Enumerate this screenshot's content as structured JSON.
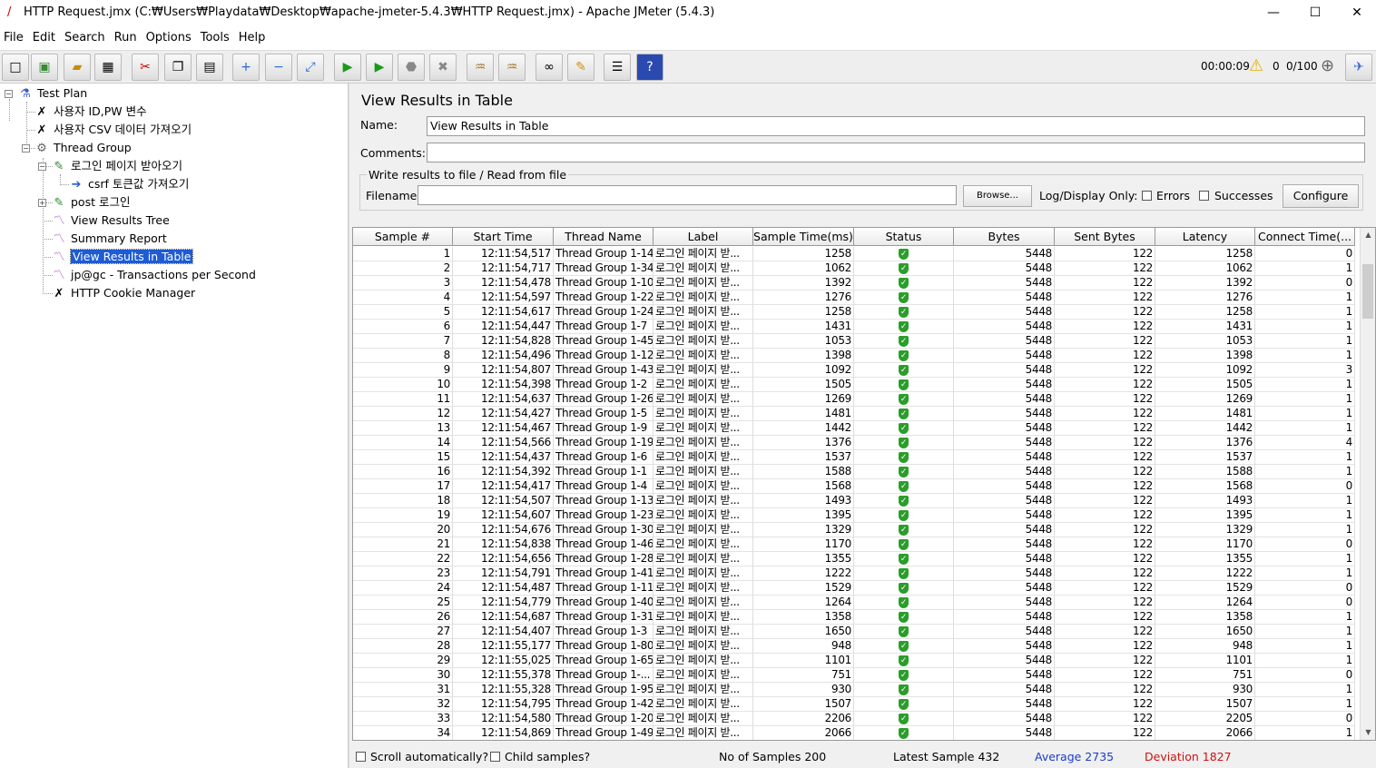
{
  "window": {
    "title": "HTTP Request.jmx (C:₩Users₩Playdata₩Desktop₩apache-jmeter-5.4.3₩HTTP Request.jmx) - Apache JMeter (5.4.3)",
    "minimize": "—",
    "maximize": "☐",
    "close": "✕"
  },
  "menu": [
    "File",
    "Edit",
    "Search",
    "Run",
    "Options",
    "Tools",
    "Help"
  ],
  "toolbar": {
    "elapsed": "00:00:09",
    "warnings": "0",
    "threads": "0/100"
  },
  "tree": [
    {
      "label": "Test Plan",
      "icon": "test-plan-icon"
    },
    {
      "label": "사용자 ID,PW 변수",
      "icon": "wrench-icon"
    },
    {
      "label": "사용자 CSV 데이터 가져오기",
      "icon": "wrench-icon"
    },
    {
      "label": "Thread Group",
      "icon": "gear-icon"
    },
    {
      "label": "로그인 페이지 받아오기",
      "icon": "pipette-icon"
    },
    {
      "label": "csrf 토큰값 가져오기",
      "icon": "extractor-icon"
    },
    {
      "label": "post 로그인",
      "icon": "pipette-icon"
    },
    {
      "label": "View Results Tree",
      "icon": "chart-icon"
    },
    {
      "label": "Summary Report",
      "icon": "chart-icon"
    },
    {
      "label": "View Results in Table",
      "icon": "chart-icon"
    },
    {
      "label": "jp@gc - Transactions per Second",
      "icon": "chart-icon"
    },
    {
      "label": "HTTP Cookie Manager",
      "icon": "wrench-icon"
    }
  ],
  "panel": {
    "title": "View Results in Table",
    "name_label": "Name:",
    "name_value": "View Results in Table",
    "comments_label": "Comments:",
    "comments_value": "",
    "file_section": "Write results to file / Read from file",
    "filename_label": "Filename",
    "filename_value": "",
    "browse": "Browse...",
    "log_display": "Log/Display Only:",
    "errors": "Errors",
    "successes": "Successes",
    "configure": "Configure"
  },
  "table": {
    "columns": [
      "Sample #",
      "Start Time",
      "Thread Name",
      "Label",
      "Sample Time(ms)",
      "Status",
      "Bytes",
      "Sent Bytes",
      "Latency",
      "Connect Time(..."
    ],
    "rows": [
      [
        "1",
        "12:11:54,517",
        "Thread Group 1-14",
        "로그인 페이지 받...",
        "1258",
        "5448",
        "122",
        "1258",
        "0"
      ],
      [
        "2",
        "12:11:54,717",
        "Thread Group 1-34",
        "로그인 페이지 받...",
        "1062",
        "5448",
        "122",
        "1062",
        "1"
      ],
      [
        "3",
        "12:11:54,478",
        "Thread Group 1-10",
        "로그인 페이지 받...",
        "1392",
        "5448",
        "122",
        "1392",
        "0"
      ],
      [
        "4",
        "12:11:54,597",
        "Thread Group 1-22",
        "로그인 페이지 받...",
        "1276",
        "5448",
        "122",
        "1276",
        "1"
      ],
      [
        "5",
        "12:11:54,617",
        "Thread Group 1-24",
        "로그인 페이지 받...",
        "1258",
        "5448",
        "122",
        "1258",
        "1"
      ],
      [
        "6",
        "12:11:54,447",
        "Thread Group 1-7",
        "로그인 페이지 받...",
        "1431",
        "5448",
        "122",
        "1431",
        "1"
      ],
      [
        "7",
        "12:11:54,828",
        "Thread Group 1-45",
        "로그인 페이지 받...",
        "1053",
        "5448",
        "122",
        "1053",
        "1"
      ],
      [
        "8",
        "12:11:54,496",
        "Thread Group 1-12",
        "로그인 페이지 받...",
        "1398",
        "5448",
        "122",
        "1398",
        "1"
      ],
      [
        "9",
        "12:11:54,807",
        "Thread Group 1-43",
        "로그인 페이지 받...",
        "1092",
        "5448",
        "122",
        "1092",
        "3"
      ],
      [
        "10",
        "12:11:54,398",
        "Thread Group 1-2",
        "로그인 페이지 받...",
        "1505",
        "5448",
        "122",
        "1505",
        "1"
      ],
      [
        "11",
        "12:11:54,637",
        "Thread Group 1-26",
        "로그인 페이지 받...",
        "1269",
        "5448",
        "122",
        "1269",
        "1"
      ],
      [
        "12",
        "12:11:54,427",
        "Thread Group 1-5",
        "로그인 페이지 받...",
        "1481",
        "5448",
        "122",
        "1481",
        "1"
      ],
      [
        "13",
        "12:11:54,467",
        "Thread Group 1-9",
        "로그인 페이지 받...",
        "1442",
        "5448",
        "122",
        "1442",
        "1"
      ],
      [
        "14",
        "12:11:54,566",
        "Thread Group 1-19",
        "로그인 페이지 받...",
        "1376",
        "5448",
        "122",
        "1376",
        "4"
      ],
      [
        "15",
        "12:11:54,437",
        "Thread Group 1-6",
        "로그인 페이지 받...",
        "1537",
        "5448",
        "122",
        "1537",
        "1"
      ],
      [
        "16",
        "12:11:54,392",
        "Thread Group 1-1",
        "로그인 페이지 받...",
        "1588",
        "5448",
        "122",
        "1588",
        "1"
      ],
      [
        "17",
        "12:11:54,417",
        "Thread Group 1-4",
        "로그인 페이지 받...",
        "1568",
        "5448",
        "122",
        "1568",
        "0"
      ],
      [
        "18",
        "12:11:54,507",
        "Thread Group 1-13",
        "로그인 페이지 받...",
        "1493",
        "5448",
        "122",
        "1493",
        "1"
      ],
      [
        "19",
        "12:11:54,607",
        "Thread Group 1-23",
        "로그인 페이지 받...",
        "1395",
        "5448",
        "122",
        "1395",
        "1"
      ],
      [
        "20",
        "12:11:54,676",
        "Thread Group 1-30",
        "로그인 페이지 받...",
        "1329",
        "5448",
        "122",
        "1329",
        "1"
      ],
      [
        "21",
        "12:11:54,838",
        "Thread Group 1-46",
        "로그인 페이지 받...",
        "1170",
        "5448",
        "122",
        "1170",
        "0"
      ],
      [
        "22",
        "12:11:54,656",
        "Thread Group 1-28",
        "로그인 페이지 받...",
        "1355",
        "5448",
        "122",
        "1355",
        "1"
      ],
      [
        "23",
        "12:11:54,791",
        "Thread Group 1-41",
        "로그인 페이지 받...",
        "1222",
        "5448",
        "122",
        "1222",
        "1"
      ],
      [
        "24",
        "12:11:54,487",
        "Thread Group 1-11",
        "로그인 페이지 받...",
        "1529",
        "5448",
        "122",
        "1529",
        "0"
      ],
      [
        "25",
        "12:11:54,779",
        "Thread Group 1-40",
        "로그인 페이지 받...",
        "1264",
        "5448",
        "122",
        "1264",
        "0"
      ],
      [
        "26",
        "12:11:54,687",
        "Thread Group 1-31",
        "로그인 페이지 받...",
        "1358",
        "5448",
        "122",
        "1358",
        "1"
      ],
      [
        "27",
        "12:11:54,407",
        "Thread Group 1-3",
        "로그인 페이지 받...",
        "1650",
        "5448",
        "122",
        "1650",
        "1"
      ],
      [
        "28",
        "12:11:55,177",
        "Thread Group 1-80",
        "로그인 페이지 받...",
        "948",
        "5448",
        "122",
        "948",
        "1"
      ],
      [
        "29",
        "12:11:55,025",
        "Thread Group 1-65",
        "로그인 페이지 받...",
        "1101",
        "5448",
        "122",
        "1101",
        "1"
      ],
      [
        "30",
        "12:11:55,378",
        "Thread Group 1-...",
        "로그인 페이지 받...",
        "751",
        "5448",
        "122",
        "751",
        "0"
      ],
      [
        "31",
        "12:11:55,328",
        "Thread Group 1-95",
        "로그인 페이지 받...",
        "930",
        "5448",
        "122",
        "930",
        "1"
      ],
      [
        "32",
        "12:11:54,795",
        "Thread Group 1-42",
        "로그인 페이지 받...",
        "1507",
        "5448",
        "122",
        "1507",
        "1"
      ],
      [
        "33",
        "12:11:54,580",
        "Thread Group 1-20",
        "로그인 페이지 받...",
        "2206",
        "5448",
        "122",
        "2205",
        "0"
      ],
      [
        "34",
        "12:11:54,869",
        "Thread Group 1-49",
        "로그인 페이지 받...",
        "2066",
        "5448",
        "122",
        "2066",
        "1"
      ]
    ]
  },
  "footer": {
    "scroll_auto": "Scroll automatically?",
    "child_samples": "Child samples?",
    "no_of_samples": "No of Samples 200",
    "latest_sample": "Latest Sample 432",
    "average": "Average 2735",
    "deviation": "Deviation 1827",
    "average_color": "#1a3ccc",
    "deviation_color": "#d01010"
  },
  "colors": {
    "selection": "#1e5bd4",
    "status_ok": "#2a9d2a"
  }
}
